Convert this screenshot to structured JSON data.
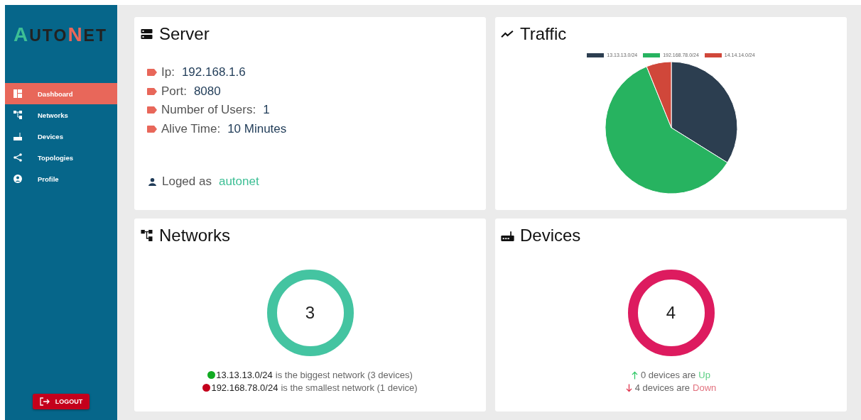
{
  "sidebar": {
    "logo": {
      "first": "A",
      "middle": "UTO",
      "accent": "N",
      "last": "ET"
    },
    "items": [
      {
        "label": "Dashboard",
        "selected": true
      },
      {
        "label": "Networks",
        "selected": false
      },
      {
        "label": "Devices",
        "selected": false
      },
      {
        "label": "Topologies",
        "selected": false
      },
      {
        "label": "Profile",
        "selected": false
      }
    ],
    "logout": "LOGOUT"
  },
  "server": {
    "title": "Server",
    "fields": [
      {
        "label": "Ip:",
        "value": "192.168.1.6"
      },
      {
        "label": "Port:",
        "value": "8080"
      },
      {
        "label": "Number of Users:",
        "value": "1"
      },
      {
        "label": "Alive Time:",
        "value": "10 Minutes"
      }
    ],
    "logged_label": "Loged as",
    "user": "autonet"
  },
  "traffic": {
    "title": "Traffic",
    "legend": [
      {
        "label": "13.13.13.0/24",
        "color": "#2c3e50"
      },
      {
        "label": "192.168.78.0/24",
        "color": "#27b360"
      },
      {
        "label": "14.14.14.0/24",
        "color": "#d0473a"
      }
    ]
  },
  "networks": {
    "title": "Networks",
    "count": "3",
    "lines": [
      {
        "network": "13.13.13.0/24",
        "text": "is the biggest network (3 devices)",
        "color": "#11aa22"
      },
      {
        "network": "192.168.78.0/24",
        "text": "is the smallest network (1 device)",
        "color": "#c4001c"
      }
    ]
  },
  "devices": {
    "title": "Devices",
    "count": "4",
    "lines": [
      {
        "kind": "up",
        "text": "0 devices are",
        "status": "Up"
      },
      {
        "kind": "down",
        "text": "4 devices are",
        "status": "Down"
      }
    ]
  }
}
